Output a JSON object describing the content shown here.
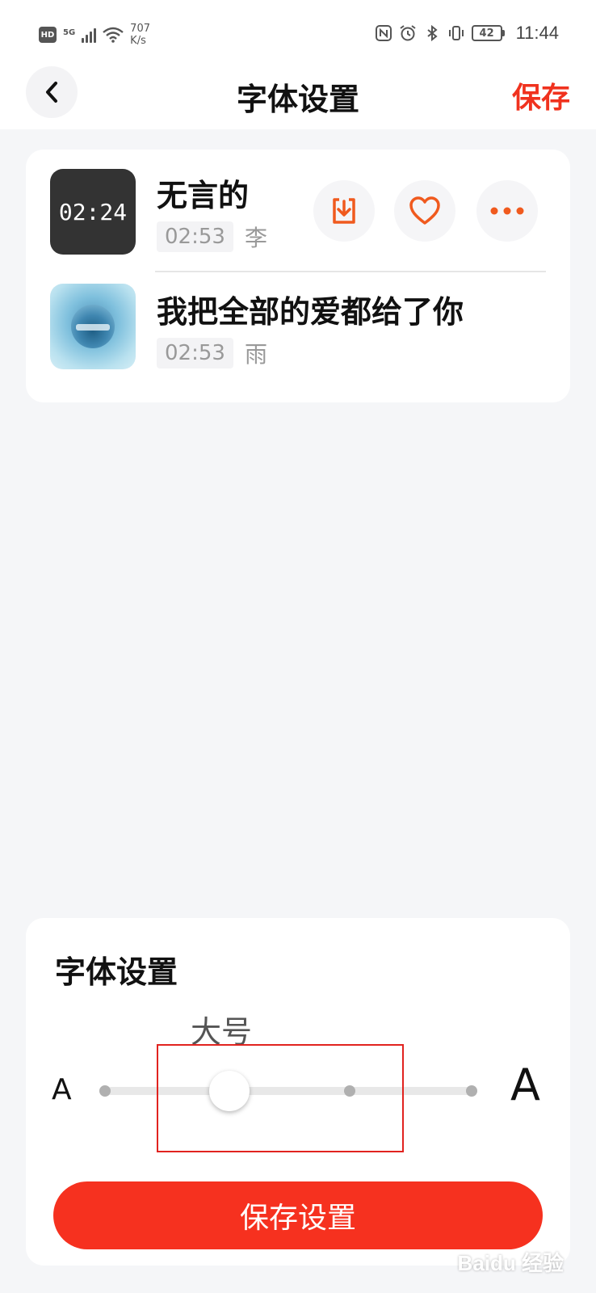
{
  "status_bar": {
    "hd": "HD",
    "network": "5G",
    "speed_value": "707",
    "speed_unit": "K/s",
    "battery": "42",
    "time": "11:44"
  },
  "header": {
    "title": "字体设置",
    "save_label": "保存",
    "back_icon": "chevron-left-icon"
  },
  "songs": [
    {
      "thumb_text": "02:24",
      "title": "无言的",
      "duration": "02:53",
      "artist": "李"
    },
    {
      "title": "我把全部的爱都给了你",
      "duration": "02:53",
      "artist": "雨"
    }
  ],
  "song_actions": [
    "download-icon",
    "heart-icon",
    "more-icon"
  ],
  "font_panel": {
    "title": "字体设置",
    "current_size_label": "大号",
    "small_a": "A",
    "large_a": "A",
    "slider": {
      "steps": 4,
      "selected_index": 1
    },
    "save_button": "保存设置"
  },
  "colors": {
    "accent_red": "#f0321e",
    "action_orange": "#f05a1e",
    "background": "#f5f6f8"
  }
}
